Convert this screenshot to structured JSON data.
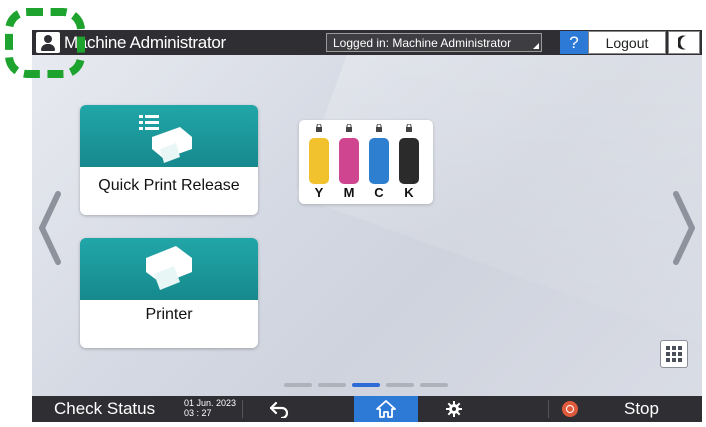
{
  "header": {
    "title": "Machine Administrator",
    "login_status": "Logged in: Machine Administrator",
    "help_label": "?",
    "logout_label": "Logout"
  },
  "tiles": [
    {
      "label": "Quick Print Release",
      "icon": "printer-document-list-icon"
    },
    {
      "label": "Printer",
      "icon": "printer-icon"
    }
  ],
  "toner": {
    "cartridges": [
      {
        "letter": "Y",
        "color": "#f2c12e"
      },
      {
        "letter": "M",
        "color": "#d0458f"
      },
      {
        "letter": "C",
        "color": "#2f7fd1"
      },
      {
        "letter": "K",
        "color": "#2b2b2b"
      }
    ]
  },
  "pagination": {
    "pages": 5,
    "current": 3
  },
  "footer": {
    "check_status": "Check Status",
    "date": "01 Jun. 2023",
    "time": "03 : 27",
    "stop_label": "Stop"
  },
  "colors": {
    "accent": "#2d7ad6",
    "tile_band": "#1a9a9d",
    "bar": "#2f2f33",
    "focus": "#1fa32f"
  }
}
